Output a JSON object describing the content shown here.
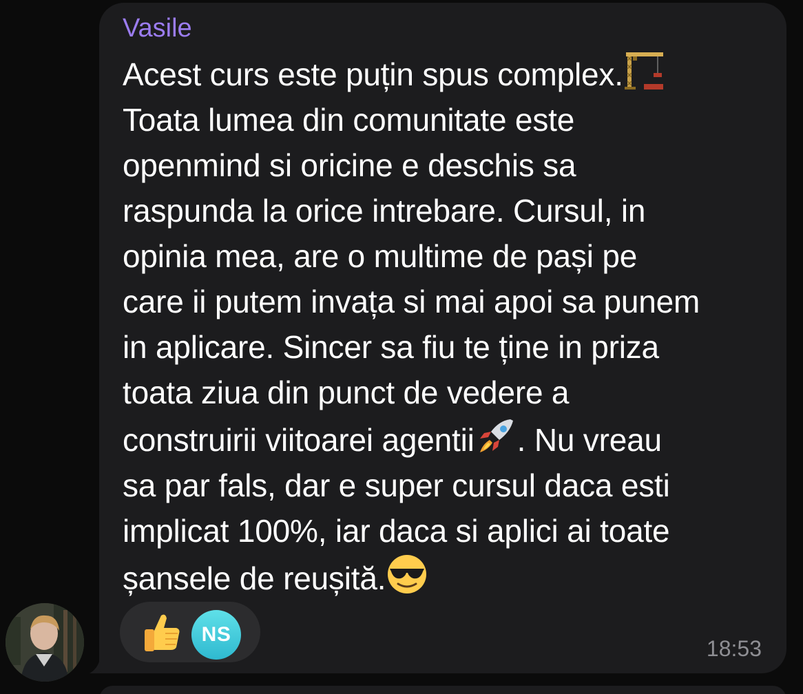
{
  "message": {
    "sender": "Vasile",
    "sender_color": "#9b7cf0",
    "lines": [
      "Acest curs este puțin spus complex.",
      "Toata lumea din comunitate este",
      "openmind si oricine e deschis sa",
      "raspunda la orice intrebare. Cursul, in",
      "opinia mea, are o multime de pași pe",
      "care ii putem invața si mai apoi sa punem",
      "in aplicare. Sincer sa fiu te ține in priza",
      "toata ziua din punct de vedere a",
      "construirii viitoarei agentii",
      ". Nu vreau",
      "sa par fals, dar e super cursul daca esti",
      "implicat 100%, iar daca si aplici ai toate",
      "șansele de reușită."
    ],
    "inline_emojis": [
      "construction-crane-emoji",
      "rocket-emoji",
      "sunglasses-face-emoji"
    ],
    "time": "18:53"
  },
  "reactions": {
    "emoji": "thumbs-up-emoji",
    "reactor_initials": "NS"
  },
  "colors": {
    "bubble": "#1c1c1e",
    "text": "#ffffff",
    "time": "#8e8e93",
    "reaction_pill": "#2c2c2e",
    "reactor_avatar": "#3cc6da"
  }
}
